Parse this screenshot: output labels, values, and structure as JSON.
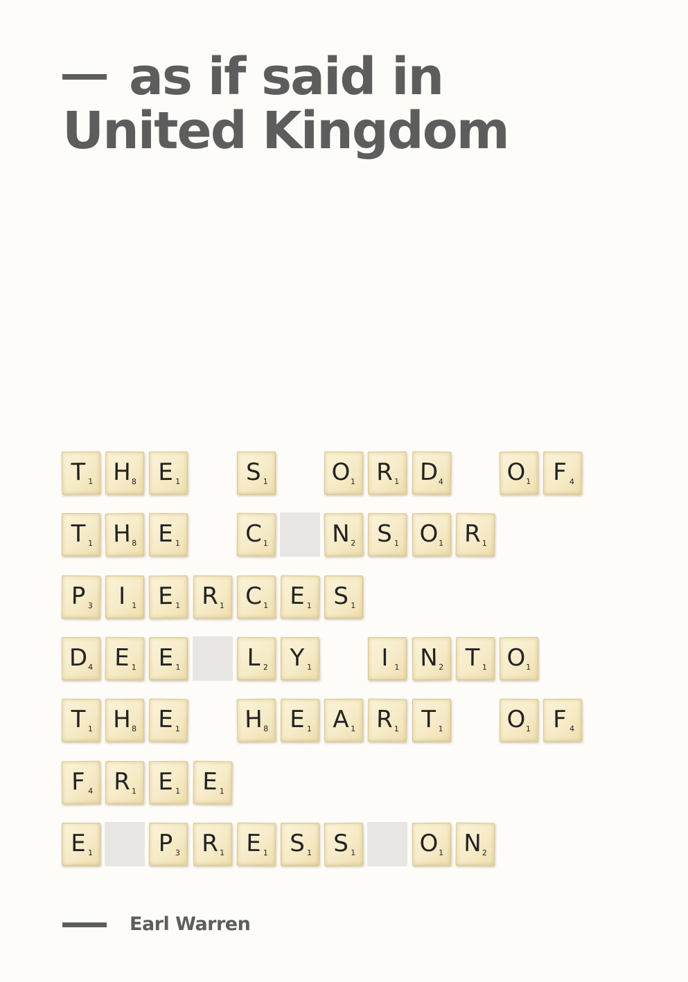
{
  "title": {
    "line1": "as if said in",
    "line2": "United Kingdom"
  },
  "author": "Earl Warren",
  "colors": {
    "text": "#5d5d5d",
    "background": "#fdfcf8",
    "tile": "#f6ebc8",
    "blank": "#e7e6e2"
  },
  "rows": [
    [
      [
        "T",
        "1"
      ],
      [
        "H",
        "8"
      ],
      [
        "E",
        "1"
      ],
      null,
      [
        "S",
        "1"
      ],
      null,
      [
        "O",
        "1"
      ],
      [
        "R",
        "1"
      ],
      [
        "D",
        "4"
      ],
      null,
      [
        "O",
        "1"
      ],
      [
        "F",
        "4"
      ]
    ],
    [
      [
        "T",
        "1"
      ],
      [
        "H",
        "8"
      ],
      [
        "E",
        "1"
      ],
      null,
      [
        "C",
        "1"
      ],
      "blank",
      [
        "N",
        "2"
      ],
      [
        "S",
        "1"
      ],
      [
        "O",
        "1"
      ],
      [
        "R",
        "1"
      ]
    ],
    [
      [
        "P",
        "3"
      ],
      [
        "I",
        "1"
      ],
      [
        "E",
        "1"
      ],
      [
        "R",
        "1"
      ],
      [
        "C",
        "1"
      ],
      [
        "E",
        "1"
      ],
      [
        "S",
        "1"
      ]
    ],
    [
      [
        "D",
        "4"
      ],
      [
        "E",
        "1"
      ],
      [
        "E",
        "1"
      ],
      "blank",
      [
        "L",
        "2"
      ],
      [
        "Y",
        "1"
      ],
      null,
      [
        "I",
        "1"
      ],
      [
        "N",
        "2"
      ],
      [
        "T",
        "1"
      ],
      [
        "O",
        "1"
      ]
    ],
    [
      [
        "T",
        "1"
      ],
      [
        "H",
        "8"
      ],
      [
        "E",
        "1"
      ],
      null,
      [
        "H",
        "8"
      ],
      [
        "E",
        "1"
      ],
      [
        "A",
        "1"
      ],
      [
        "R",
        "1"
      ],
      [
        "T",
        "1"
      ],
      null,
      [
        "O",
        "1"
      ],
      [
        "F",
        "4"
      ]
    ],
    [
      [
        "F",
        "4"
      ],
      [
        "R",
        "1"
      ],
      [
        "E",
        "1"
      ],
      [
        "E",
        "1"
      ]
    ],
    [
      [
        "E",
        "1"
      ],
      "blank",
      [
        "P",
        "3"
      ],
      [
        "R",
        "1"
      ],
      [
        "E",
        "1"
      ],
      [
        "S",
        "1"
      ],
      [
        "S",
        "1"
      ],
      "blank",
      [
        "O",
        "1"
      ],
      [
        "N",
        "2"
      ]
    ]
  ]
}
